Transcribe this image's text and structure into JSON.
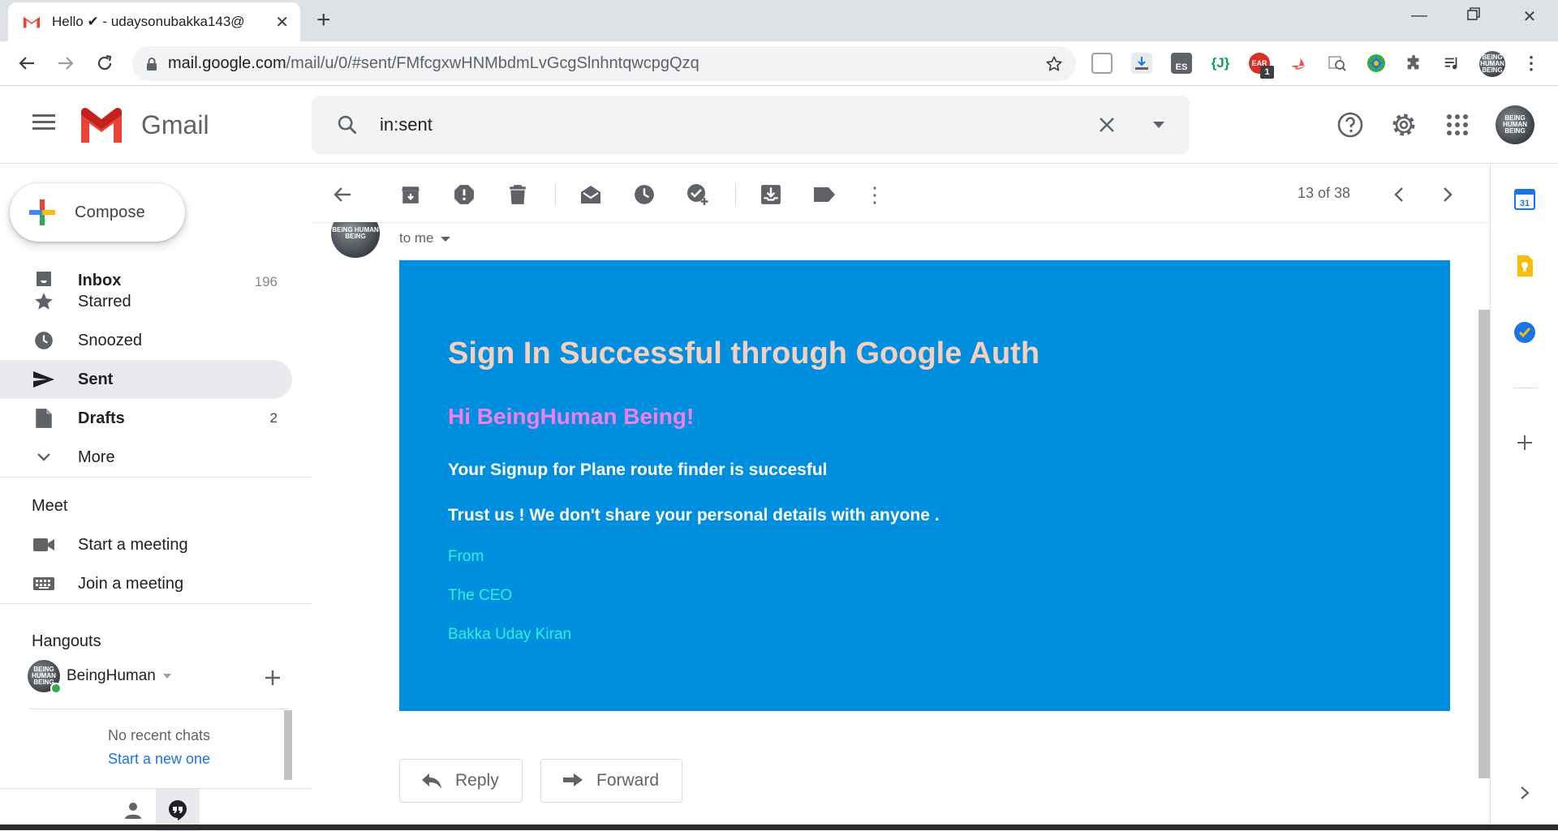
{
  "browser": {
    "tab_title": "Hello ✔ - udaysonubakka143@",
    "url_host": "mail.google.com",
    "url_path": "/mail/u/0/#sent/FMfcgxwHNMbdmLvGcgSlnhntqwcpgQzq",
    "badge_count": "1",
    "ext_j": "{J}",
    "ext_es": "ES"
  },
  "gmail": {
    "product_name": "Gmail",
    "search_query": "in:sent"
  },
  "sidebar": {
    "compose_label": "Compose",
    "items": [
      {
        "label": "Inbox",
        "count": "196"
      },
      {
        "label": "Starred",
        "count": ""
      },
      {
        "label": "Snoozed",
        "count": ""
      },
      {
        "label": "Sent",
        "count": ""
      },
      {
        "label": "Drafts",
        "count": "2"
      },
      {
        "label": "More",
        "count": ""
      }
    ],
    "meet_header": "Meet",
    "meet_items": [
      "Start a meeting",
      "Join a meeting"
    ],
    "hangouts_header": "Hangouts",
    "hangouts_user": "BeingHuman",
    "no_chats": "No recent chats",
    "start_new": "Start a new one"
  },
  "message_toolbar": {
    "pager": "13 of 38"
  },
  "message": {
    "to_line": "to me",
    "email_title": "Sign In Successful through Google Auth",
    "greeting": "Hi BeingHuman Being!",
    "line1": "Your Signup for Plane route finder is succesful",
    "line2": "Trust us ! We don't share your personal details with anyone .",
    "sig_from": "From",
    "sig_role": "The CEO",
    "sig_name": "Bakka Uday Kiran",
    "reply_label": "Reply",
    "forward_label": "Forward"
  },
  "avatar_text": "BEING HUMAN BEING",
  "colors": {
    "email_bg": "#008fdf",
    "title": "#f5cfc0",
    "greeting": "#f27ef2",
    "signature": "#2cf2dc",
    "gmail_red": "#ea4335"
  }
}
